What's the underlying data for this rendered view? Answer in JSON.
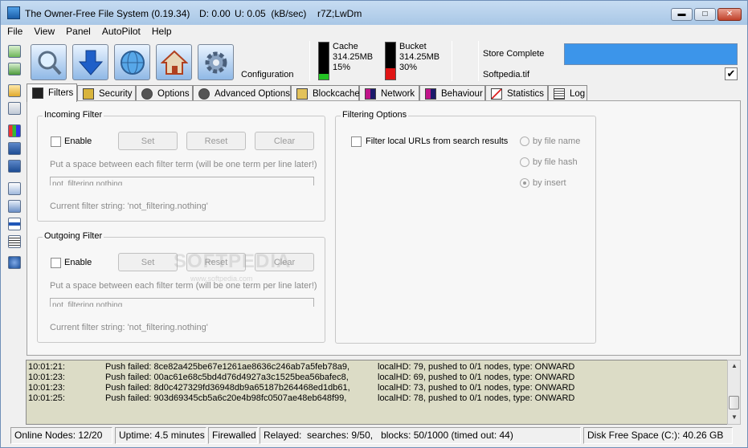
{
  "window": {
    "title": "The Owner-Free File System (0.19.34)",
    "download": "D: 0.00",
    "upload": "U: 0.05  (kB/sec)",
    "node_id": "r7Z;LwDm",
    "controls": {
      "minimize": "▬",
      "maximize": "□",
      "close": "✕"
    }
  },
  "menu": [
    "File",
    "View",
    "Panel",
    "AutoPilot",
    "Help"
  ],
  "toolbar": {
    "buttons": [
      {
        "name": "search-icon"
      },
      {
        "name": "download-icon"
      },
      {
        "name": "network-globe-icon"
      },
      {
        "name": "home-icon"
      },
      {
        "name": "gear-icon"
      }
    ],
    "config_label": "Configuration",
    "cache": {
      "label": "Cache",
      "size": "314.25MB",
      "percent": "15%",
      "fill": 0.15,
      "color": "#22c322"
    },
    "bucket": {
      "label": "Bucket",
      "size": "314.25MB",
      "percent": "30%",
      "fill": 0.3,
      "color": "#e01515"
    },
    "store_label": "Store Complete",
    "store_color": "#3c95ea",
    "file_label": "Softpedia.tif",
    "file_checked": "✔"
  },
  "tabs": [
    {
      "label": "Filters",
      "icon": "filter-icon",
      "active": true
    },
    {
      "label": "Security",
      "icon": "security-icon"
    },
    {
      "label": "Options",
      "icon": "options-gear-icon"
    },
    {
      "label": "Advanced Options",
      "icon": "advanced-gear-icon"
    },
    {
      "label": "Blockcache",
      "icon": "folder-icon"
    },
    {
      "label": "Network",
      "icon": "network-icon"
    },
    {
      "label": "Behaviour",
      "icon": "behaviour-icon"
    },
    {
      "label": "Statistics",
      "icon": "statistics-icon"
    },
    {
      "label": "Log",
      "icon": "log-icon"
    }
  ],
  "incoming": {
    "title": "Incoming Filter",
    "enable": "Enable",
    "set": "Set",
    "reset": "Reset",
    "clear": "Clear",
    "hint": "Put a space between each filter term (will be one term per line later!)",
    "field_value": "not_filtering.nothing",
    "current": "Current filter string: 'not_filtering.nothing'"
  },
  "outgoing": {
    "title": "Outgoing Filter",
    "enable": "Enable",
    "set": "Set",
    "reset": "Reset",
    "clear": "Clear",
    "hint": "Put a space between each filter term (will be one term per line later!)",
    "field_value": "not_filtering.nothing",
    "current": "Current filter string: 'not_filtering.nothing'"
  },
  "filtering_options": {
    "title": "Filtering Options",
    "checkbox": "Filter local URLs from search results",
    "radios": [
      "by file name",
      "by file hash",
      "by insert"
    ],
    "selected": "by insert"
  },
  "watermark": {
    "main": "SOFTPEDIA",
    "sub": "www.softpedia.com"
  },
  "log": [
    {
      "time": "10:01:21:",
      "msg": "Push failed: 8ce82a425be67e1261ae8636c246ab7a5feb78a9,",
      "detail": "localHD: 79, pushed to 0/1 nodes, type: ONWARD"
    },
    {
      "time": "10:01:23:",
      "msg": "Push failed: 00ac61e68c5bd4d76d4927a3c1525bea56bafec8,",
      "detail": "localHD: 69, pushed to 0/1 nodes, type: ONWARD"
    },
    {
      "time": "10:01:23:",
      "msg": "Push failed: 8d0c427329fd36948db9a65187b264468ed1db61,",
      "detail": "localHD: 73, pushed to 0/1 nodes, type: ONWARD"
    },
    {
      "time": "10:01:25:",
      "msg": "Push failed: 903d69345cb5a6c20e4b98fc0507ae48eb648f99,",
      "detail": "localHD: 78, pushed to 0/1 nodes, type: ONWARD"
    }
  ],
  "status": {
    "nodes": "Online Nodes: 12/20",
    "uptime": "Uptime: 4.5 minutes",
    "firewall": "Firewalled",
    "relayed": "Relayed:  searches: 9/50,   blocks: 50/1000 (timed out: 44)",
    "disk": "Disk Free Space (C:): 40.26 GB"
  }
}
